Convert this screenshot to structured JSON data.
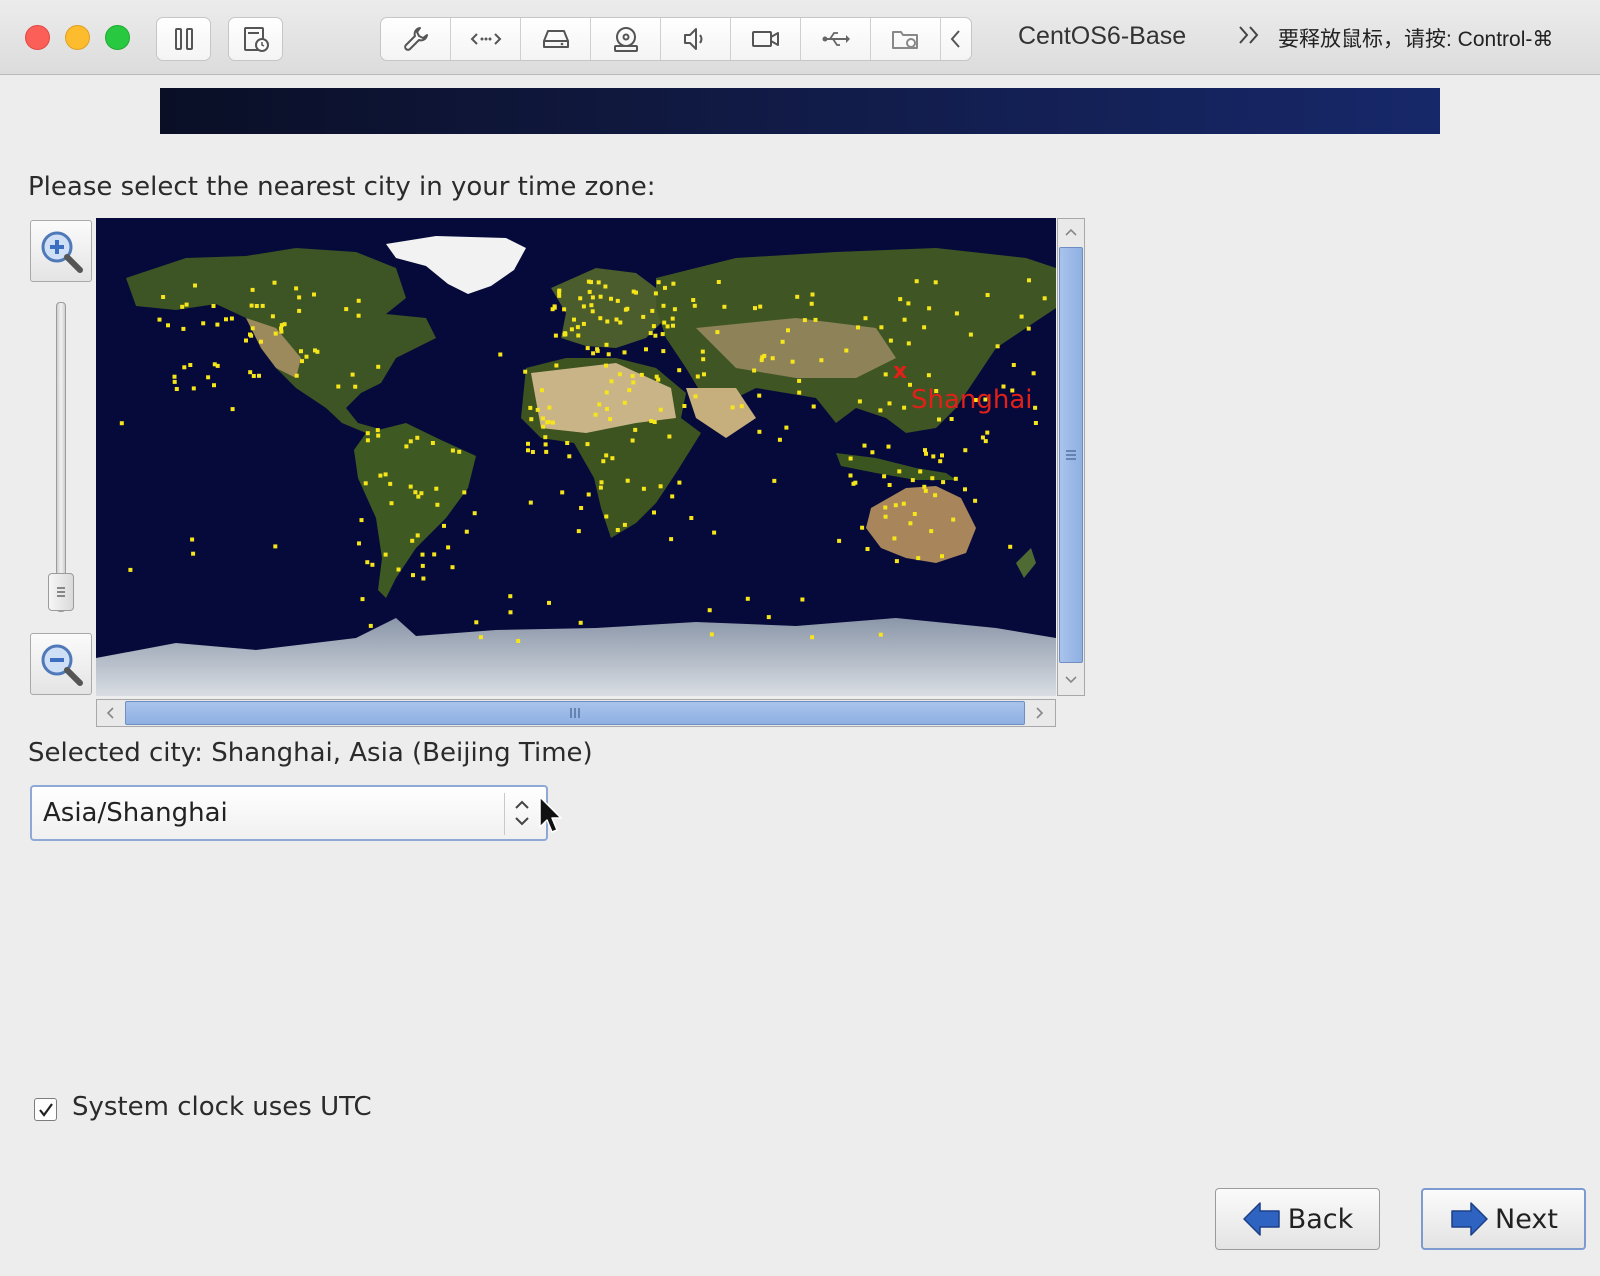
{
  "window": {
    "vm_name": "CentOS6-Base",
    "release_hint": "要释放鼠标，请按: Control-⌘"
  },
  "toolbar": {
    "buttons": [
      {
        "name": "pause-button",
        "icon": "pause-icon"
      },
      {
        "name": "snapshot-button",
        "icon": "snapshot-icon"
      },
      {
        "name": "settings-button",
        "icon": "wrench-icon"
      },
      {
        "name": "network-button",
        "icon": "network-icon"
      },
      {
        "name": "hard-disk-button",
        "icon": "hard-disk-icon"
      },
      {
        "name": "cd-dvd-button",
        "icon": "cd-dvd-icon"
      },
      {
        "name": "sound-button",
        "icon": "speaker-icon"
      },
      {
        "name": "camera-button",
        "icon": "video-camera-icon"
      },
      {
        "name": "usb-button",
        "icon": "usb-icon"
      },
      {
        "name": "shared-folder-button",
        "icon": "shared-folder-icon"
      },
      {
        "name": "collapse-button",
        "icon": "chevron-left-icon"
      }
    ]
  },
  "installer": {
    "prompt": "Please select the nearest city in your time zone:",
    "map": {
      "marker_city": "Shanghai",
      "marker_symbol": "x",
      "city_dot_color": "#f5e51a",
      "marker_color": "#e1201a",
      "ocean_color": "#060a3a"
    },
    "selected_city": "Selected city: Shanghai, Asia (Beijing Time)",
    "timezone_select": {
      "value": "Asia/Shanghai"
    },
    "utc_checkbox": {
      "label": "System clock uses UTC",
      "checked": true
    },
    "back_label": "Back",
    "next_label": "Next"
  }
}
